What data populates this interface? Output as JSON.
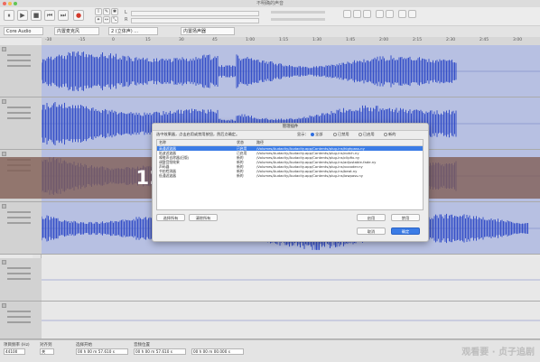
{
  "window": {
    "title": "不明确的声音"
  },
  "toolbar": {
    "buttons": [
      "⏸",
      "▶",
      "■",
      "⏮",
      "⏭",
      "●"
    ],
    "tools": [
      "I",
      "✎",
      "✦",
      "↔",
      "✱",
      "⤡"
    ],
    "meter_labels": [
      "L",
      "R"
    ]
  },
  "devicebar": {
    "host": "Core Audio",
    "mic": "内置麦克风",
    "channels": "2 (立体声) ...",
    "speaker": "内置扬声器"
  },
  "ruler_ticks": [
    "-30",
    "-15",
    "0",
    "15",
    "30",
    "45",
    "1:00",
    "1:15",
    "1:30",
    "1:45",
    "2:00",
    "2:15",
    "2:30",
    "2:45",
    "3:00"
  ],
  "scale_ticks": [
    "1.0",
    "0.5",
    "0.0",
    "-0.5",
    "-1.0"
  ],
  "banner": {
    "text": "12月27日实时剪辑的录音软件"
  },
  "dialog": {
    "title": "管理插件",
    "hint": "选中效果器，点击启用或禁用按钮，然后点确定。",
    "show_label": "显示：",
    "filters": [
      "全部",
      "已禁用",
      "已启用",
      "新的"
    ],
    "columns": [
      "名称",
      "状态",
      "路径"
    ],
    "rows": [
      {
        "name": "高通滤波器",
        "state": "已启用",
        "path": "/Volumes/Audacity/Audacity.app/Contents/plug-ins/highpass.ny",
        "selected": true
      },
      {
        "name": "陷波滤波器",
        "state": "已启用",
        "path": "/Volumes/Audacity/Audacity.app/Contents/plug-ins/notch.ny"
      },
      {
        "name": "嘀嗒声去除器(旧版)",
        "state": "新的",
        "path": "/Volumes/Audacity/Audacity.app/Contents/plug-ins/clipfix.ny"
      },
      {
        "name": "调整音频效果",
        "state": "新的",
        "path": "/Volumes/Audacity/Audacity.app/Contents/plug-ins/adjustable-fade.ny"
      },
      {
        "name": "声码器",
        "state": "新的",
        "path": "/Volumes/Audacity/Audacity.app/Contents/plug-ins/vocoder.ny"
      },
      {
        "name": "节拍检测器",
        "state": "新的",
        "path": "/Volumes/Audacity/Audacity.app/Contents/plug-ins/beat.ny"
      },
      {
        "name": "低通滤波器",
        "state": "新的",
        "path": "/Volumes/Audacity/Audacity.app/Contents/plug-ins/lowpass.ny"
      }
    ],
    "select_all": "选择所有",
    "clear_all": "清除所有",
    "enable": "启用",
    "disable": "禁用",
    "cancel": "取消",
    "ok": "确定"
  },
  "bottombar": {
    "rate_label": "项目频率 (Hz)",
    "snap_label": "对齐到",
    "sel_label": "选择开始",
    "audio_pos_label": "音频位置",
    "rate_value": "44100",
    "snap_value": "关",
    "sel_start": "00 h 00 m 57.610 s",
    "sel_end": "00 h 00 m 57.610 s",
    "audio_pos": "00 h 00 m 00.000 s"
  },
  "watermark": "观看要 · 贞子追剧",
  "colors": {
    "wave": "#3650c8",
    "wave_bg": "#b7c0e2",
    "banner": "#805c52",
    "accent": "#3b7ce6"
  }
}
